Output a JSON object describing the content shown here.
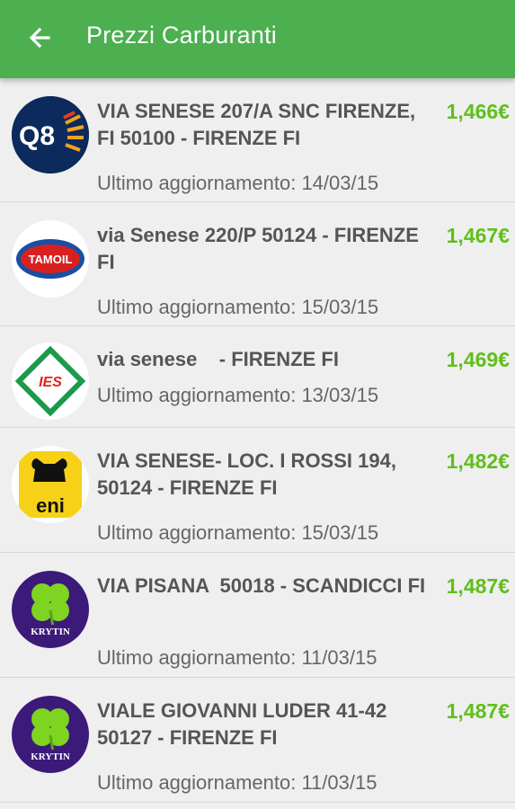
{
  "appbar": {
    "title": "Prezzi Carburanti",
    "back_icon": "arrow-back-icon",
    "color": "#4caf50"
  },
  "stations": [
    {
      "brand": "Q8",
      "logo_icon": "q8-logo-icon",
      "address": "VIA SENESE 207/A SNC FIRENZE, FI 50100 - FIRENZE FI",
      "price": "1,466€",
      "updated": "Ultimo aggiornamento: 14/03/15"
    },
    {
      "brand": "TAMOIL",
      "logo_icon": "tamoil-logo-icon",
      "address": "via Senese 220/P 50124 - FIRENZE FI",
      "price": "1,467€",
      "updated": "Ultimo aggiornamento: 15/03/15"
    },
    {
      "brand": "IES",
      "logo_icon": "ies-logo-icon",
      "address": "via senese    - FIRENZE FI",
      "price": "1,469€",
      "updated": "Ultimo aggiornamento: 13/03/15"
    },
    {
      "brand": "eni",
      "logo_icon": "eni-logo-icon",
      "address": "VIA SENESE- LOC. I ROSSI 194, 50124 - FIRENZE FI",
      "price": "1,482€",
      "updated": "Ultimo aggiornamento: 15/03/15"
    },
    {
      "brand": "KRYTIN",
      "logo_icon": "clover-logo-icon",
      "address": "VIA PISANA  50018 - SCANDICCI FI",
      "price": "1,487€",
      "updated": "Ultimo aggiornamento: 11/03/15"
    },
    {
      "brand": "KRYTIN",
      "logo_icon": "clover-logo-icon",
      "address": "VIALE GIOVANNI LUDER 41-42 50127 - FIRENZE FI",
      "price": "1,487€",
      "updated": "Ultimo aggiornamento: 11/03/15"
    }
  ],
  "colors": {
    "price": "#5fbf1b",
    "address": "#555555",
    "background": "#efefef"
  }
}
